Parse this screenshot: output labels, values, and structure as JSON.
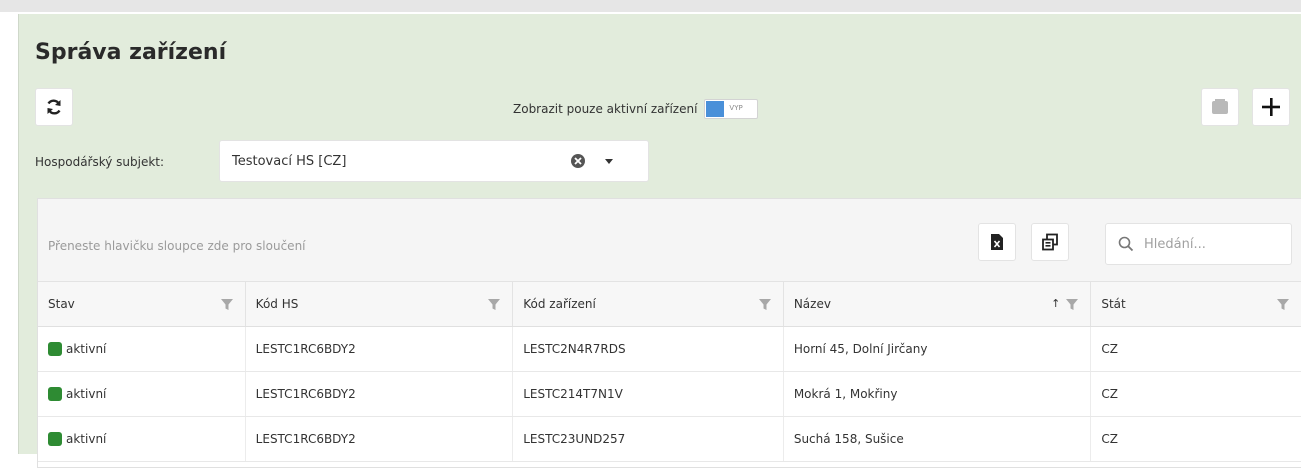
{
  "app": {
    "title": "Správa zařízení"
  },
  "toolbar": {
    "toggle_label": "Zobrazit pouze aktivní zařízení",
    "toggle_state": "VYP",
    "refresh_icon": "refresh-icon",
    "save_icon": "save-icon",
    "add_icon": "plus-icon"
  },
  "subject": {
    "label": "Hospodářský subjekt:",
    "value": "Testovací HS [CZ]"
  },
  "grid": {
    "group_hint": "Přeneste hlavičku sloupce zde pro sloučení",
    "search_placeholder": "Hledání...",
    "columns": [
      "Stav",
      "Kód HS",
      "Kód zařízení",
      "Název",
      "Stát"
    ],
    "sort_indicator": "↑",
    "rows": [
      {
        "status": "aktivní",
        "hs": "LESTC1RC6BDY2",
        "device": "LESTC2N4R7RDS",
        "name": "Horní 45, Dolní Jirčany",
        "country": "CZ"
      },
      {
        "status": "aktivní",
        "hs": "LESTC1RC6BDY2",
        "device": "LESTC214T7N1V",
        "name": "Mokrá 1, Mokřiny",
        "country": "CZ"
      },
      {
        "status": "aktivní",
        "hs": "LESTC1RC6BDY2",
        "device": "LESTC23UND257",
        "name": "Suchá 158, Sušice",
        "country": "CZ"
      }
    ]
  },
  "colors": {
    "panel": "#e2ecdc",
    "status_active": "#2e8b33",
    "toggle_on": "#4a90d9"
  }
}
